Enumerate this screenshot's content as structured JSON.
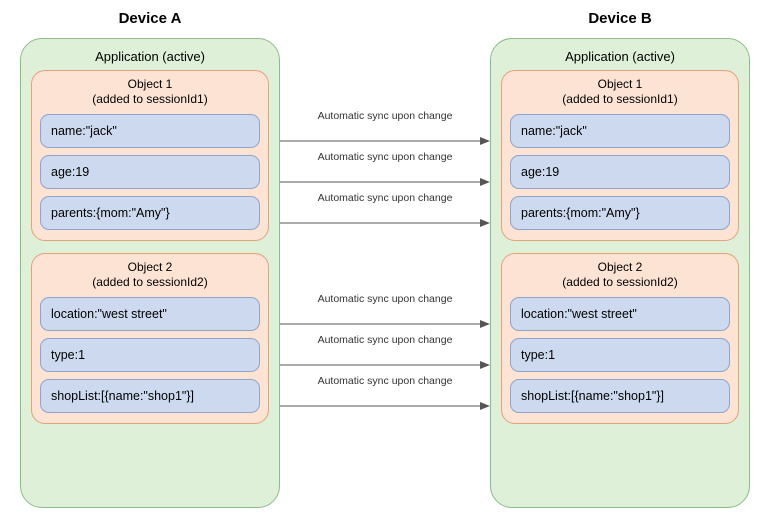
{
  "deviceA": {
    "title": "Device A",
    "appTitle": "Application (active)"
  },
  "deviceB": {
    "title": "Device B",
    "appTitle": "Application (active)"
  },
  "object1": {
    "title": "Object 1",
    "subtitle": "(added to sessionId1)",
    "props": {
      "p1": "name:\"jack\"",
      "p2": "age:19",
      "p3": "parents:{mom:\"Amy\"}"
    }
  },
  "object2": {
    "title": "Object 2",
    "subtitle": "(added to sessionId2)",
    "props": {
      "p1": "location:\"west street\"",
      "p2": "type:1",
      "p3": "shopList:[{name:\"shop1\"}]"
    }
  },
  "syncLabel": "Automatic sync upon change"
}
